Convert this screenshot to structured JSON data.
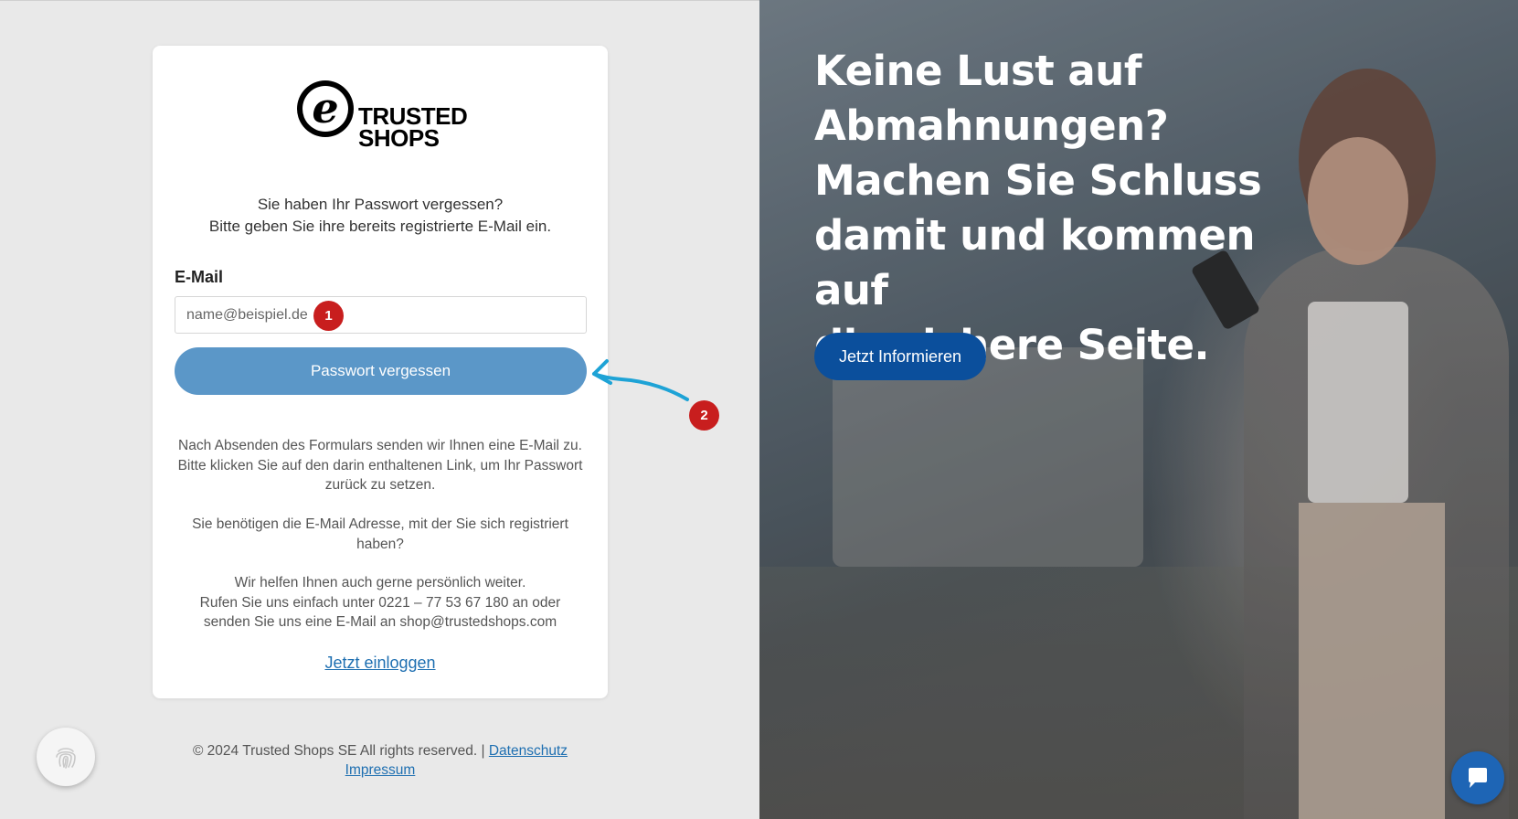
{
  "brand": {
    "logo_letter": "e",
    "logo_line1": "TRUSTED",
    "logo_line2": "SHOPS"
  },
  "form": {
    "intro_line1": "Sie haben Ihr Passwort vergessen?",
    "intro_line2": "Bitte geben Sie ihre bereits registrierte E-Mail ein.",
    "email_label": "E-Mail",
    "email_placeholder": "name@beispiel.de",
    "email_value": "",
    "submit_label": "Passwort vergessen",
    "info_1_line1": "Nach Absenden des Formulars senden wir Ihnen eine E-Mail zu.",
    "info_1_line2": "Bitte klicken Sie auf den darin enthaltenen Link, um Ihr Passwort",
    "info_1_line3": "zurück zu setzen.",
    "info_2_line1": "Sie benötigen die E-Mail Adresse, mit der Sie sich registriert",
    "info_2_line2": "haben?",
    "info_3_line1": "Wir helfen Ihnen auch gerne persönlich weiter.",
    "info_3_line2": "Rufen Sie uns einfach unter 0221 – 77 53 67 180 an oder",
    "info_3_line3": "senden Sie uns eine E-Mail an shop@trustedshops.com",
    "login_link": "Jetzt einloggen"
  },
  "footer": {
    "copyright": "© 2024 Trusted Shops SE All rights reserved. |",
    "privacy_link": "Datenschutz",
    "imprint_link": "Impressum"
  },
  "annotations": {
    "marker_1": "1",
    "marker_2": "2",
    "marker_color": "#c81e1e",
    "arrow_color": "#1ea3d6"
  },
  "promo": {
    "headline_line1": "Keine Lust auf",
    "headline_line2": "Abmahnungen?",
    "headline_line3": "Machen Sie Schluss",
    "headline_line4": "damit und kommen auf",
    "headline_line5": "die sichere Seite.",
    "cta_label": "Jetzt Informieren"
  },
  "icons": {
    "fingerprint": "fingerprint-icon",
    "chat": "chat-icon"
  },
  "colors": {
    "submit_button": "#5b97c8",
    "cta_button": "#0b4f9c",
    "link": "#1e6fb1",
    "chat_button": "#1e65b5"
  }
}
